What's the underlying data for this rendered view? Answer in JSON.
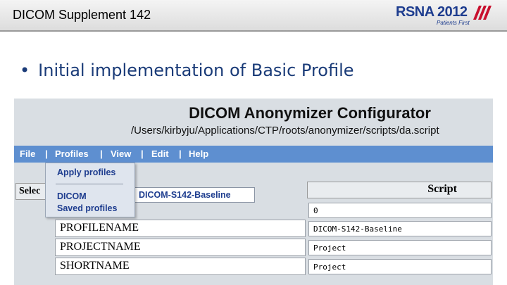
{
  "slide": {
    "title": "DICOM Supplement 142",
    "bullet": "Initial implementation of Basic Profile"
  },
  "logo": {
    "main": "RSNA 2012",
    "sub": "Patients First"
  },
  "app": {
    "title": "DICOM Anonymizer Configurator",
    "path": "/Users/kirbyju/Applications/CTP/roots/anonymizer/scripts/da.script",
    "menu": [
      "File",
      "Profiles",
      "View",
      "Edit",
      "Help"
    ],
    "menu_separator": "|",
    "dropdown": {
      "items": [
        "Apply profiles",
        "DICOM",
        "Saved profiles"
      ]
    },
    "select_tab": "Selec",
    "profile_field": "DICOM-S142-Baseline",
    "script_header": "Script",
    "rows": [
      {
        "label": "",
        "value": "0"
      },
      {
        "label": "PROFILENAME",
        "value": "DICOM-S142-Baseline"
      },
      {
        "label": "PROJECTNAME",
        "value": "Project"
      },
      {
        "label": "SHORTNAME",
        "value": "Project"
      }
    ]
  },
  "colors": {
    "menubar": "#5e8fd0",
    "bullet_text": "#1a3b78",
    "logo_blue": "#1e3d8f",
    "logo_stripes": "#c8102e"
  }
}
